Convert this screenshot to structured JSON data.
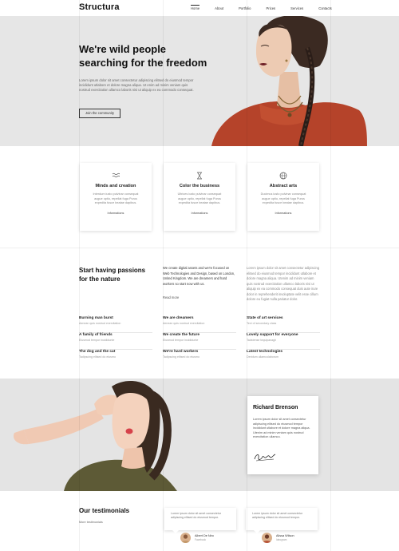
{
  "header": {
    "logo": "Structura",
    "nav": [
      "Home",
      "About",
      "Portfolio",
      "Prices",
      "Services",
      "Contacts"
    ]
  },
  "hero": {
    "title_line1": "We're wild people",
    "title_line2": "searching for the freedom",
    "text": "Lorem ipsum dolor sit amet consectetur adipiscing elitsed do eiusmod tempor incididunt utlabore et dolore magna aliqua. Ut enim ad minim veniam quis nostrud exercitation ullamco laboris nisi ut aliquip ex ea commodo consequat.",
    "button": "Join the community"
  },
  "features": [
    {
      "icon": "waves-icon",
      "title": "Minds and creation",
      "text": "Interdum iusto pulvinar consequat augue optio, repellat fuga Purus expedita fusce beatae dapibus.",
      "link": "Informations"
    },
    {
      "icon": "hourglass-icon",
      "title": "Color the business",
      "text": "Ultrices iusto pulvinar consequat augue optio, repellat fuga Purus expedita fusce beatae dapibus.",
      "link": "Informations"
    },
    {
      "icon": "globe-icon",
      "title": "Abstract arts",
      "text": "Ducimus iusto pulvinar consequat augue optio, repellat fuga Purus expedita fusce beatae dapibus.",
      "link": "Informations"
    }
  ],
  "passions": {
    "title_line1": "Start having passions",
    "title_line2": "for the nature",
    "col2_text": "We create digital assets and we're focused on Web Technologies and Design, based on London, United Kingdom. We are dreamers and hard workers so start now with us.",
    "read_more": "Read more",
    "col3_text": "Lorem ipsum dolor sit amet consectetur adipiscing elitsed do eiusmod tempor incididunt utlabore et dolore magna aliqua. Utenim ad minim veniam quis nostrud exercitation ullamco laboris nisi ut aliquip ex ea commodo consequat duis aute irure dolor in reprehenderit involuptate velit esse cillum dolore eu fugiat nulla pariatur dolor.",
    "lists": [
      [
        {
          "title": "Burning man burst",
          "sub": "Aenean quis nostrud exercitation"
        },
        {
          "title": "A family of friends",
          "sub": "Eiusmod tempor incididunte"
        },
        {
          "title": "The dog and the cat",
          "sub": "Tadipscing elitsed do eiusmo"
        }
      ],
      [
        {
          "title": "We are dreamers",
          "sub": "Aenean quis nostrud exercitation"
        },
        {
          "title": "We create the future",
          "sub": "Eiusmod tempor incididunte"
        },
        {
          "title": "We're hard workers",
          "sub": "Tadipscing elitsed do eiusmo"
        }
      ],
      [
        {
          "title": "State of art services",
          "sub": "Text of secondary class"
        },
        {
          "title": "Lovely support for everyone",
          "sub": "Tadstense tequipanagh"
        },
        {
          "title": "Latest technologies",
          "sub": "Deridum ullamcolaborum"
        }
      ]
    ]
  },
  "profile": {
    "name": "Richard Brenson",
    "text": "Lorem ipsum dolor sit amet consectetur adipiscing elitsed do eiusmod tempor incididunt utlabore et dolore magna aliqua. Utenim ad minim veniam quis nostrud exercitation ullamco."
  },
  "testimonials": {
    "title": "Our testimonials",
    "more": "More testimonials",
    "items": [
      {
        "text": "Lorem ipsum dolor sit amet consectetur adipiscing elitsed do eiusmod tempor.",
        "name": "Albert De Niro",
        "role": "Facebook"
      },
      {
        "text": "Lorem ipsum dolor sit amet consectetur adipiscing elitsed do eiusmod tempor.",
        "name": "Alissa Wilson",
        "role": "Ideogram"
      }
    ]
  }
}
